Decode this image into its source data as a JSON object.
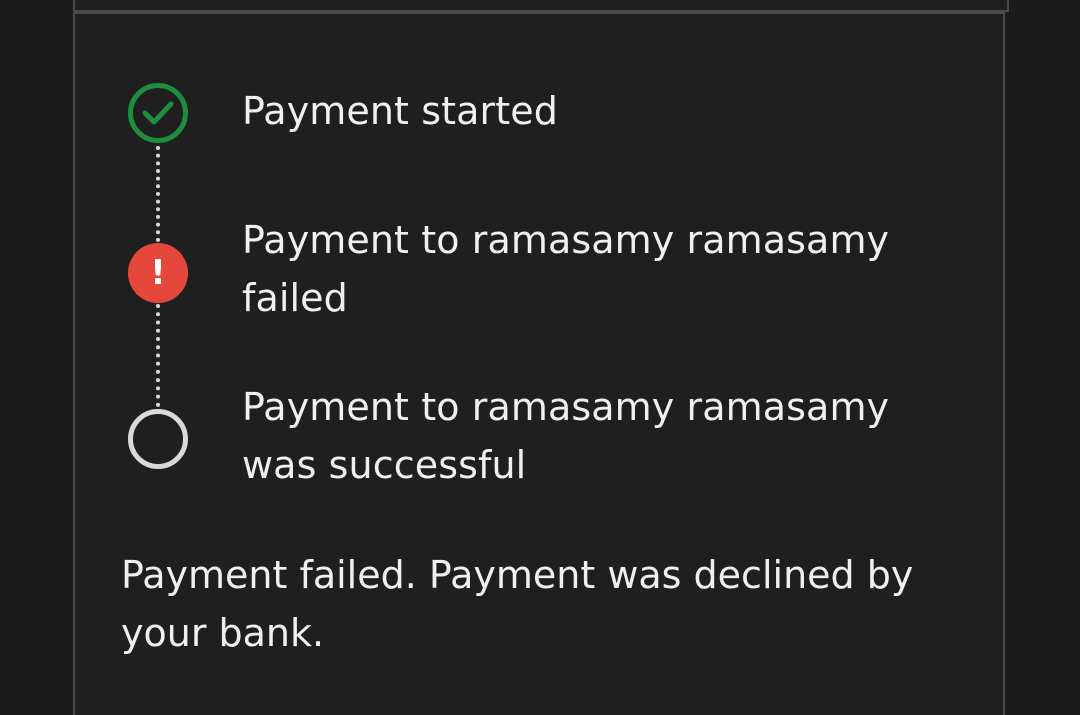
{
  "timeline": {
    "steps": [
      {
        "label": "Payment started",
        "status": "success",
        "icon": "check-circle-icon",
        "color": "#1e8e3e"
      },
      {
        "label": "Payment to ramasamy ramasamy failed",
        "status": "failed",
        "icon": "error-icon",
        "color": "#e5473a",
        "icon_text": "!"
      },
      {
        "label": "Payment to ramasamy ramasamy was successful",
        "status": "pending",
        "icon": "empty-circle-icon",
        "color": "#d9d9d9"
      }
    ]
  },
  "failure_message": "Payment failed. Payment was declined by your bank."
}
